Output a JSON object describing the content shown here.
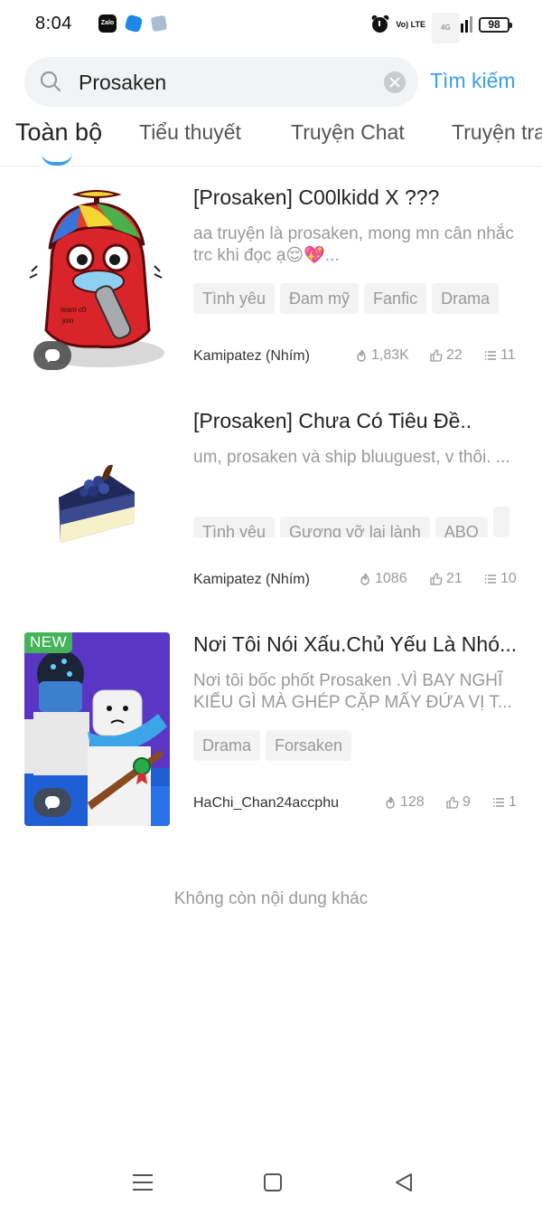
{
  "status_bar": {
    "time": "8:04",
    "apps": [
      "zalo-icon",
      "messenger-icon",
      "cloud-icon"
    ],
    "zalo_label": "Zalo",
    "volte_label": "Vo) LTE",
    "net_label": "4G",
    "battery": "98"
  },
  "search": {
    "value": "Prosaken",
    "button_label": "Tìm kiếm"
  },
  "tabs": [
    {
      "label": "Toàn bộ",
      "active": true
    },
    {
      "label": "Tiểu thuyết"
    },
    {
      "label": "Truyện Chat"
    },
    {
      "label": "Truyện tra"
    }
  ],
  "results": [
    {
      "title": "[Prosaken] C00lkidd X ???",
      "description": "aa truyện là prosaken, mong mn cân nhắc trc khi đọc ạ😌💖...",
      "tags": [
        "Tình yêu",
        "Đam mỹ",
        "Fanfic",
        "Drama"
      ],
      "author": "Kamipatez (Nhím)",
      "views": "1,83K",
      "likes": "22",
      "chapters": "11",
      "badge_chat": true
    },
    {
      "title": "[Prosaken] Chưa Có Tiêu Đề..",
      "description": "um, prosaken và ship bluuguest, v thôi. ...",
      "tags": [
        "Tình yêu",
        "Gương vỡ lại lành",
        "ABO",
        ""
      ],
      "author": "Kamipatez (Nhím)",
      "views": "1086",
      "likes": "21",
      "chapters": "10",
      "badge_chat": false
    },
    {
      "title": "Nơi Tôi Nói Xấu.Chủ Yếu Là Nhó...",
      "description": "Nơi tôi bốc phốt Prosaken .VÌ BAY NGHĨ KIỂU GÌ MÀ GHÉP CẶP MẤY ĐỨA VỊ T...",
      "tags": [
        "Drama",
        "Forsaken"
      ],
      "author": "HaChi_Chan24accphu",
      "views": "128",
      "likes": "9",
      "chapters": "1",
      "badge_new": "NEW",
      "badge_chat": true
    }
  ],
  "end_message": "Không còn nội dung khác",
  "colors": {
    "accent": "#3d9ee8",
    "new_badge": "#44b35a",
    "muted_text": "#999999"
  },
  "nav": {
    "icons": [
      "menu-icon",
      "home-icon",
      "back-icon"
    ]
  }
}
